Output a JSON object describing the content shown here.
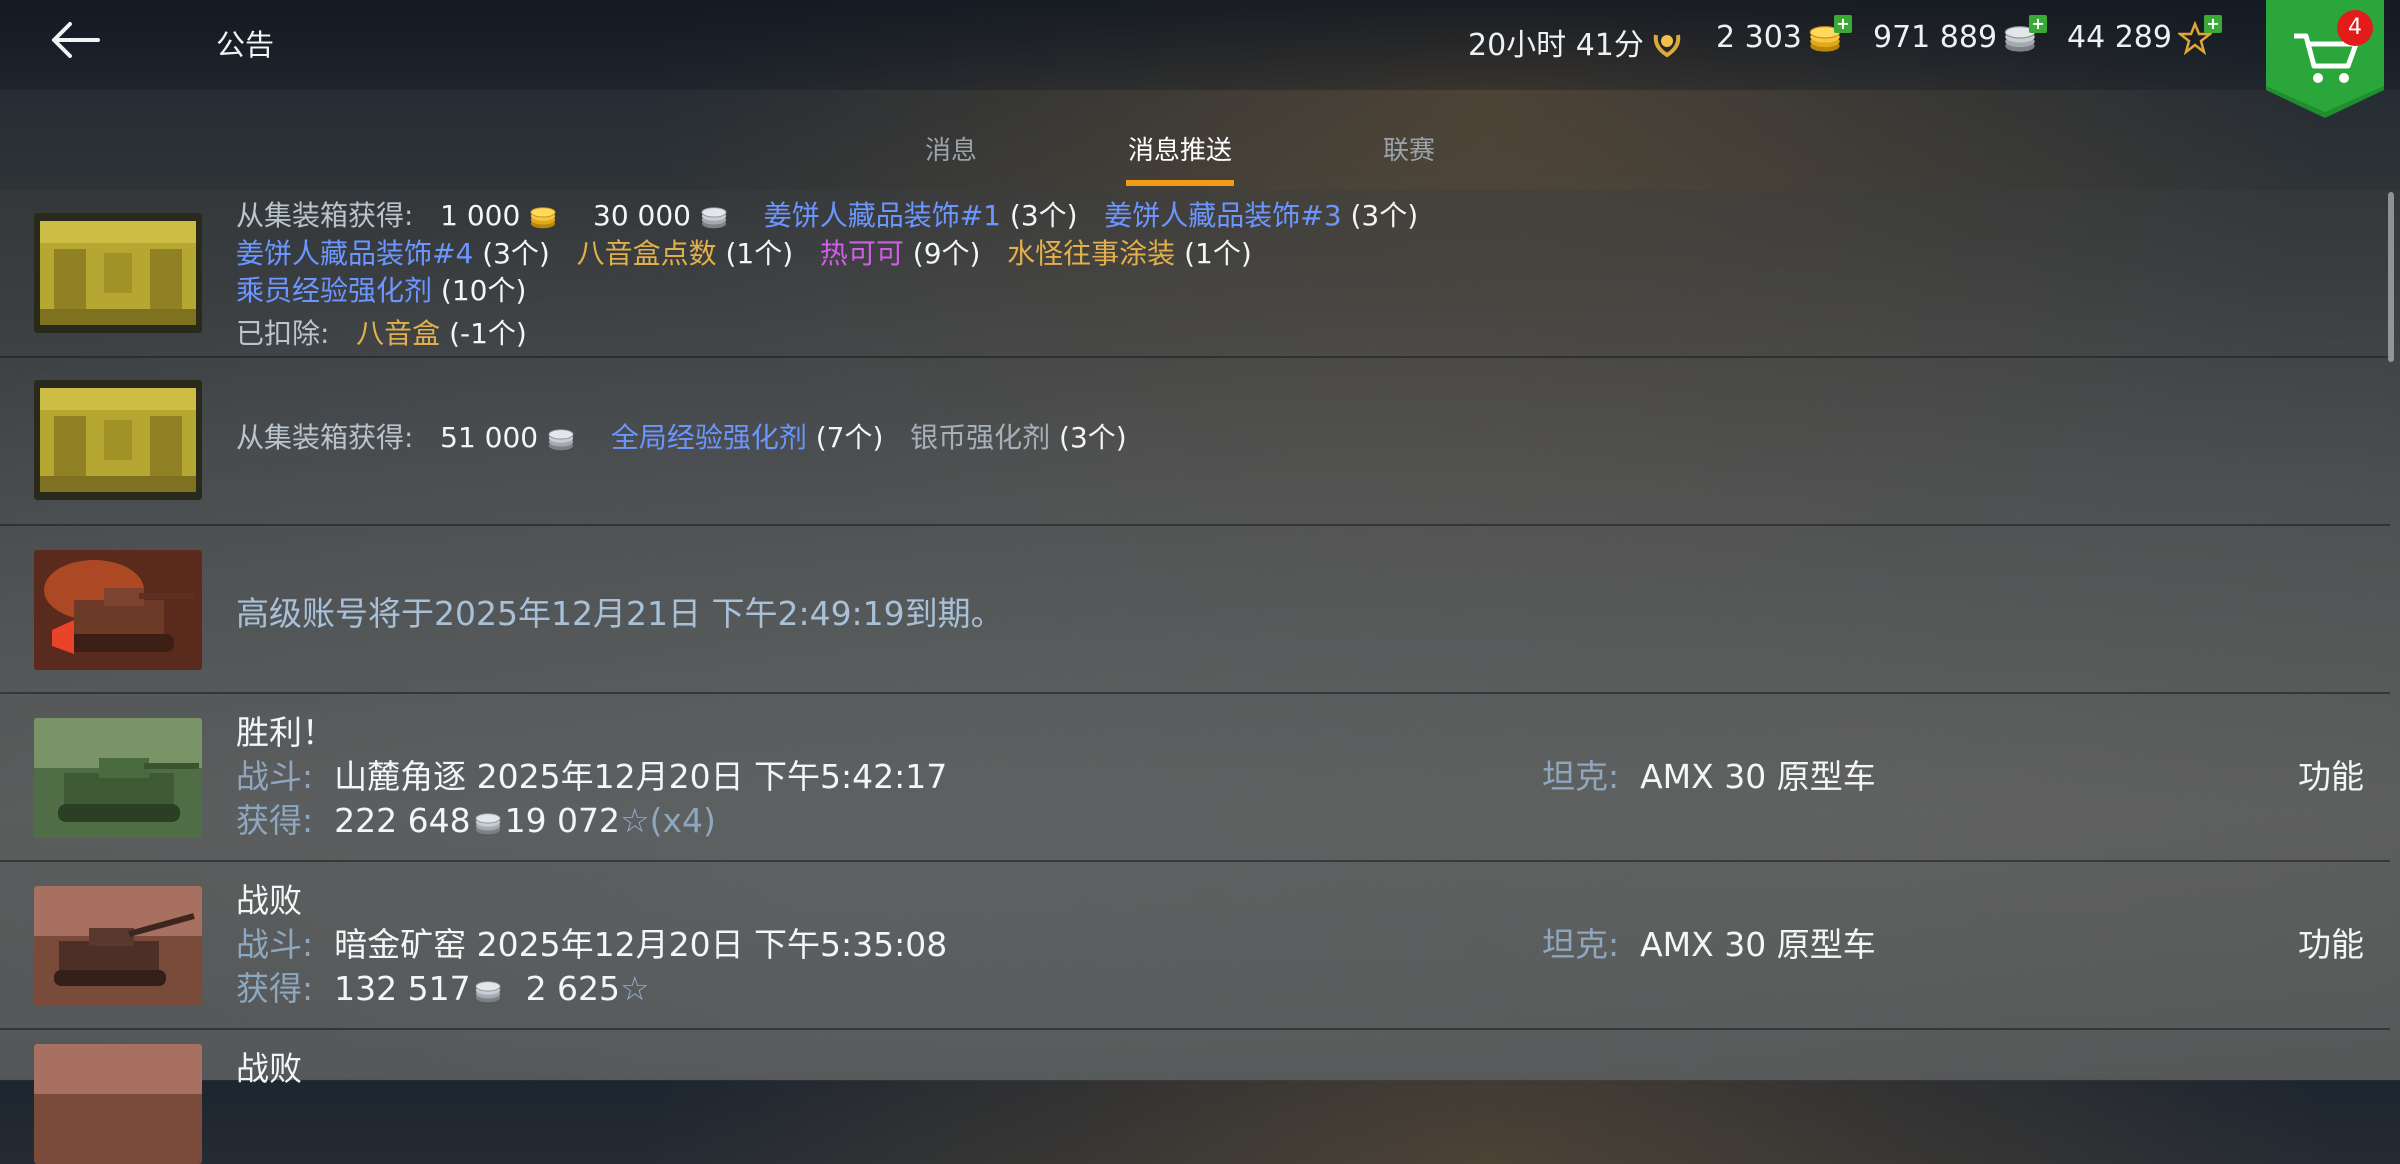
{
  "header": {
    "title": "公告",
    "premium_time": "20小时 41分",
    "gold": "2 303",
    "silver": "971 889",
    "free_xp": "44 289",
    "cart_badge": "4"
  },
  "tabs": [
    {
      "label": "消息"
    },
    {
      "label": "消息推送"
    },
    {
      "label": "联赛"
    }
  ],
  "rows": {
    "r1": {
      "obtained_label": "从集装箱获得:",
      "gold_amount": "1 000",
      "silver_amount": "30 000",
      "item1": "姜饼人藏品装饰#1",
      "item1_qty": "(3个)",
      "item2": "姜饼人藏品装饰#3",
      "item2_qty": "(3个)",
      "item3": "姜饼人藏品装饰#4",
      "item3_qty": "(3个)",
      "item4": "八音盒点数",
      "item4_qty": "(1个)",
      "item5": "热可可",
      "item5_qty": "(9个)",
      "item6": "水怪往事涂装",
      "item6_qty": "(1个)",
      "item7": "乘员经验强化剂",
      "item7_qty": "(10个)",
      "deducted_label": "已扣除:",
      "deducted_item": "八音盒",
      "deducted_qty": "(-1个)"
    },
    "r2": {
      "obtained_label": "从集装箱获得:",
      "silver_amount": "51 000",
      "item1": "全局经验强化剂",
      "item1_qty": "(7个)",
      "item2": "银币强化剂",
      "item2_qty": "(3个)"
    },
    "r3": {
      "text": "高级账号将于2025年12月21日 下午2:49:19到期。"
    },
    "r4": {
      "result": "胜利！",
      "battle_label": "战斗:",
      "battle_value": "山麓角逐 2025年12月20日 下午5:42:17",
      "earned_label": "获得:",
      "silver": "222 648",
      "xp": "19 072",
      "multiplier": "(x4)",
      "tank_label": "坦克:",
      "tank_value": "AMX 30 原型车",
      "action": "功能"
    },
    "r5": {
      "result": "战败",
      "battle_label": "战斗:",
      "battle_value": "暗金矿窑 2025年12月20日 下午5:35:08",
      "earned_label": "获得:",
      "silver": "132 517",
      "xp": "2 625",
      "tank_label": "坦克:",
      "tank_value": "AMX 30 原型车",
      "action": "功能"
    },
    "r6": {
      "result": "战败"
    }
  },
  "colors": {
    "accent": "#f39b16",
    "link_blue": "#6c96ff",
    "item_gold": "#e2b04a",
    "item_purple": "#d15ce8",
    "cart_green": "#1f8f2e",
    "badge_red": "#e31b1b"
  },
  "icons": [
    "back-arrow-icon",
    "premium-laurel-icon",
    "gold-coins-icon",
    "silver-coins-icon",
    "free-xp-star-icon",
    "plus-icon",
    "cart-icon",
    "xp-star-icon"
  ]
}
